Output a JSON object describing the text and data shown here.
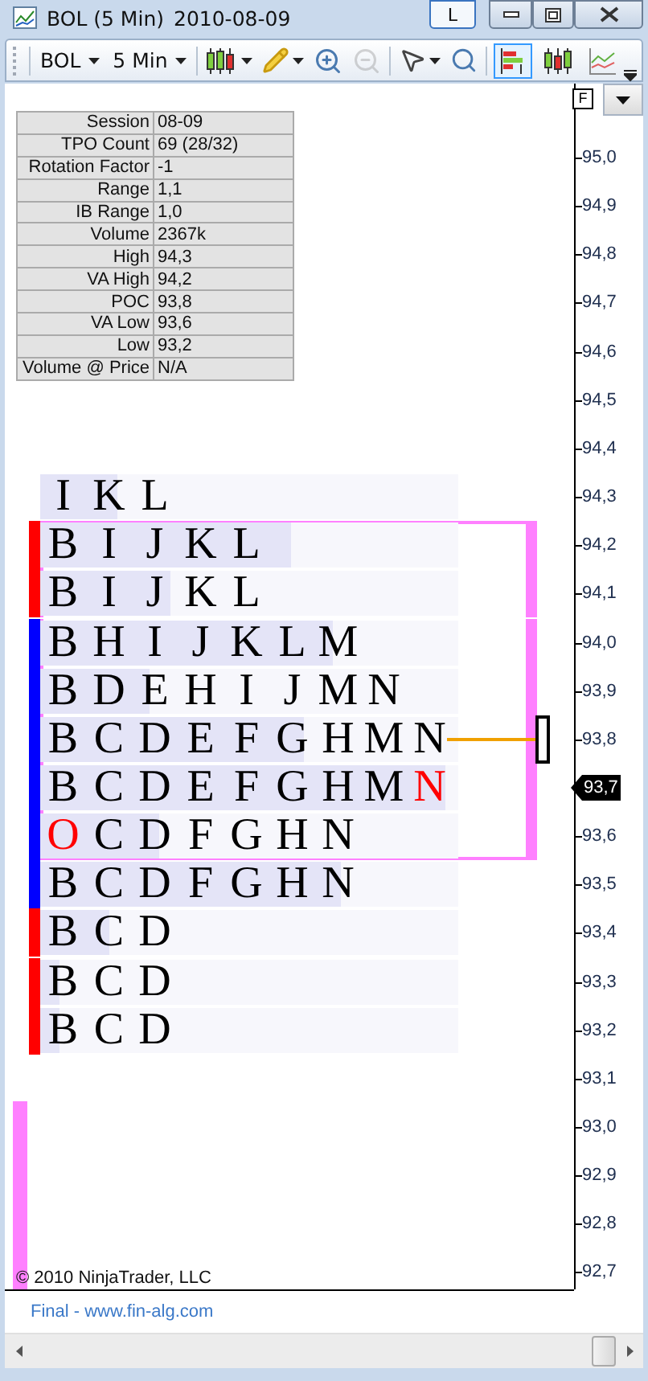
{
  "window": {
    "title": "BOL (5 Min)",
    "date": "2010-08-09",
    "link_button": "L"
  },
  "toolbar": {
    "instrument": "BOL",
    "interval": "5 Min",
    "tools": [
      {
        "kind": "candles",
        "menu": true,
        "disabled": false
      },
      {
        "kind": "pencil",
        "menu": true,
        "disabled": false
      },
      {
        "kind": "zoom-in",
        "menu": false,
        "disabled": false
      },
      {
        "kind": "zoom-out",
        "menu": false,
        "disabled": true
      },
      {
        "kind": "pointer",
        "menu": true,
        "disabled": false
      },
      {
        "kind": "find",
        "menu": false,
        "disabled": false
      }
    ],
    "toggles": [
      {
        "kind": "tpo",
        "selected": true
      },
      {
        "kind": "bars",
        "selected": false
      },
      {
        "kind": "line",
        "selected": false
      }
    ]
  },
  "stats": [
    {
      "label": "Session",
      "value": "08-09"
    },
    {
      "label": "TPO Count",
      "value": "69 (28/32)"
    },
    {
      "label": "Rotation Factor",
      "value": "-1"
    },
    {
      "label": "Range",
      "value": "1,1"
    },
    {
      "label": "IB Range",
      "value": "1,0"
    },
    {
      "label": "Volume",
      "value": "2367k"
    },
    {
      "label": "High",
      "value": "94,3"
    },
    {
      "label": "VA High",
      "value": "94,2"
    },
    {
      "label": "POC",
      "value": "93,8"
    },
    {
      "label": "VA Low",
      "value": "93,6"
    },
    {
      "label": "Low",
      "value": "93,2"
    },
    {
      "label": "Volume @ Price",
      "value": "N/A"
    }
  ],
  "rows": [
    {
      "level": 0.185,
      "in_value_area": false,
      "poc": false,
      "letters": [
        {
          "text": "I",
          "color": "#000000"
        },
        {
          "text": "K",
          "color": "#000000"
        },
        {
          "text": "L",
          "color": "#000000"
        }
      ]
    },
    {
      "level": 0.6,
      "in_value_area": true,
      "poc": false,
      "segment": {
        "color": "#ff0000"
      },
      "letters": [
        {
          "text": "B",
          "color": "#000000"
        },
        {
          "text": "I",
          "color": "#000000"
        },
        {
          "text": "J",
          "color": "#000000"
        },
        {
          "text": "K",
          "color": "#000000"
        },
        {
          "text": "L",
          "color": "#000000"
        }
      ]
    },
    {
      "level": 0.31,
      "in_value_area": true,
      "poc": false,
      "segment": {
        "color": "#ff0000"
      },
      "letters": [
        {
          "text": "B",
          "color": "#000000"
        },
        {
          "text": "I",
          "color": "#000000"
        },
        {
          "text": "J",
          "color": "#000000"
        },
        {
          "text": "K",
          "color": "#000000"
        },
        {
          "text": "L",
          "color": "#000000"
        }
      ]
    },
    {
      "level": 0.7,
      "in_value_area": true,
      "poc": false,
      "segment": {
        "color": "#0000ff"
      },
      "letters": [
        {
          "text": "B",
          "color": "#000000"
        },
        {
          "text": "H",
          "color": "#000000"
        },
        {
          "text": "I",
          "color": "#000000"
        },
        {
          "text": "J",
          "color": "#000000"
        },
        {
          "text": "K",
          "color": "#000000"
        },
        {
          "text": "L",
          "color": "#000000"
        },
        {
          "text": "M",
          "color": "#000000"
        }
      ]
    },
    {
      "level": 0.26,
      "in_value_area": true,
      "poc": false,
      "segment": {
        "color": "#0000ff"
      },
      "letters": [
        {
          "text": "B",
          "color": "#000000"
        },
        {
          "text": "D",
          "color": "#000000"
        },
        {
          "text": "E",
          "color": "#000000"
        },
        {
          "text": "H",
          "color": "#000000"
        },
        {
          "text": "I",
          "color": "#000000"
        },
        {
          "text": "J",
          "color": "#000000"
        },
        {
          "text": "M",
          "color": "#000000"
        },
        {
          "text": "N",
          "color": "#000000"
        }
      ]
    },
    {
      "level": 0.63,
      "in_value_area": true,
      "poc": true,
      "segment": {
        "color": "#0000ff"
      },
      "letters": [
        {
          "text": "B",
          "color": "#000000"
        },
        {
          "text": "C",
          "color": "#000000"
        },
        {
          "text": "D",
          "color": "#000000"
        },
        {
          "text": "E",
          "color": "#000000"
        },
        {
          "text": "F",
          "color": "#000000"
        },
        {
          "text": "G",
          "color": "#000000"
        },
        {
          "text": "H",
          "color": "#000000"
        },
        {
          "text": "M",
          "color": "#000000"
        },
        {
          "text": "N",
          "color": "#000000"
        }
      ]
    },
    {
      "level": 0.97,
      "in_value_area": true,
      "poc": false,
      "segment": {
        "color": "#0000ff"
      },
      "letters": [
        {
          "text": "B",
          "color": "#000000"
        },
        {
          "text": "C",
          "color": "#000000"
        },
        {
          "text": "D",
          "color": "#000000"
        },
        {
          "text": "E",
          "color": "#000000"
        },
        {
          "text": "F",
          "color": "#000000"
        },
        {
          "text": "G",
          "color": "#000000"
        },
        {
          "text": "H",
          "color": "#000000"
        },
        {
          "text": "M",
          "color": "#000000"
        },
        {
          "text": "N",
          "color": "#ff0000"
        }
      ]
    },
    {
      "level": 0.285,
      "in_value_area": true,
      "poc": false,
      "segment": {
        "color": "#0000ff"
      },
      "letters": [
        {
          "text": "O",
          "color": "#ff0000"
        },
        {
          "text": "C",
          "color": "#000000"
        },
        {
          "text": "D",
          "color": "#000000"
        },
        {
          "text": "F",
          "color": "#000000"
        },
        {
          "text": "G",
          "color": "#000000"
        },
        {
          "text": "H",
          "color": "#000000"
        },
        {
          "text": "N",
          "color": "#000000"
        }
      ]
    },
    {
      "level": 0.72,
      "in_value_area": false,
      "poc": false,
      "segment": {
        "color": "#0000ff"
      },
      "letters": [
        {
          "text": "B",
          "color": "#000000"
        },
        {
          "text": "C",
          "color": "#000000"
        },
        {
          "text": "D",
          "color": "#000000"
        },
        {
          "text": "F",
          "color": "#000000"
        },
        {
          "text": "G",
          "color": "#000000"
        },
        {
          "text": "H",
          "color": "#000000"
        },
        {
          "text": "N",
          "color": "#000000"
        }
      ]
    },
    {
      "level": 0.165,
      "in_value_area": false,
      "poc": false,
      "segment": {
        "color": "#ff0000"
      },
      "letters": [
        {
          "text": "B",
          "color": "#000000"
        },
        {
          "text": "C",
          "color": "#000000"
        },
        {
          "text": "D",
          "color": "#000000"
        }
      ]
    },
    {
      "level": 0.046,
      "in_value_area": false,
      "poc": false,
      "segment": {
        "color": "#ff0000"
      },
      "letters": [
        {
          "text": "B",
          "color": "#000000"
        },
        {
          "text": "C",
          "color": "#000000"
        },
        {
          "text": "D",
          "color": "#000000"
        }
      ]
    },
    {
      "level": 0.046,
      "in_value_area": false,
      "poc": false,
      "segment": {
        "color": "#ff0000"
      },
      "letters": [
        {
          "text": "B",
          "color": "#000000"
        },
        {
          "text": "C",
          "color": "#000000"
        },
        {
          "text": "D",
          "color": "#000000"
        }
      ]
    }
  ],
  "price_axis": {
    "menu_label": "F",
    "labels": [
      {
        "text": "95,0",
        "selected": false
      },
      {
        "text": "94,9",
        "selected": false
      },
      {
        "text": "94,8",
        "selected": false
      },
      {
        "text": "94,7",
        "selected": false
      },
      {
        "text": "94,6",
        "selected": false
      },
      {
        "text": "94,5",
        "selected": false
      },
      {
        "text": "94,4",
        "selected": false
      },
      {
        "text": "94,3",
        "selected": false
      },
      {
        "text": "94,2",
        "selected": false
      },
      {
        "text": "94,1",
        "selected": false
      },
      {
        "text": "94,0",
        "selected": false
      },
      {
        "text": "93,9",
        "selected": false
      },
      {
        "text": "93,8",
        "selected": false
      },
      {
        "text": "93,7",
        "selected": true
      },
      {
        "text": "93,6",
        "selected": false
      },
      {
        "text": "93,5",
        "selected": false
      },
      {
        "text": "93,4",
        "selected": false
      },
      {
        "text": "93,3",
        "selected": false
      },
      {
        "text": "93,2",
        "selected": false
      },
      {
        "text": "93,1",
        "selected": false
      },
      {
        "text": "93,0",
        "selected": false
      },
      {
        "text": "92,9",
        "selected": false
      },
      {
        "text": "92,8",
        "selected": false
      },
      {
        "text": "92,7",
        "selected": false
      }
    ]
  },
  "copyright": "© 2010 NinjaTrader, LLC",
  "footer_link": "Final - www.fin-alg.com"
}
